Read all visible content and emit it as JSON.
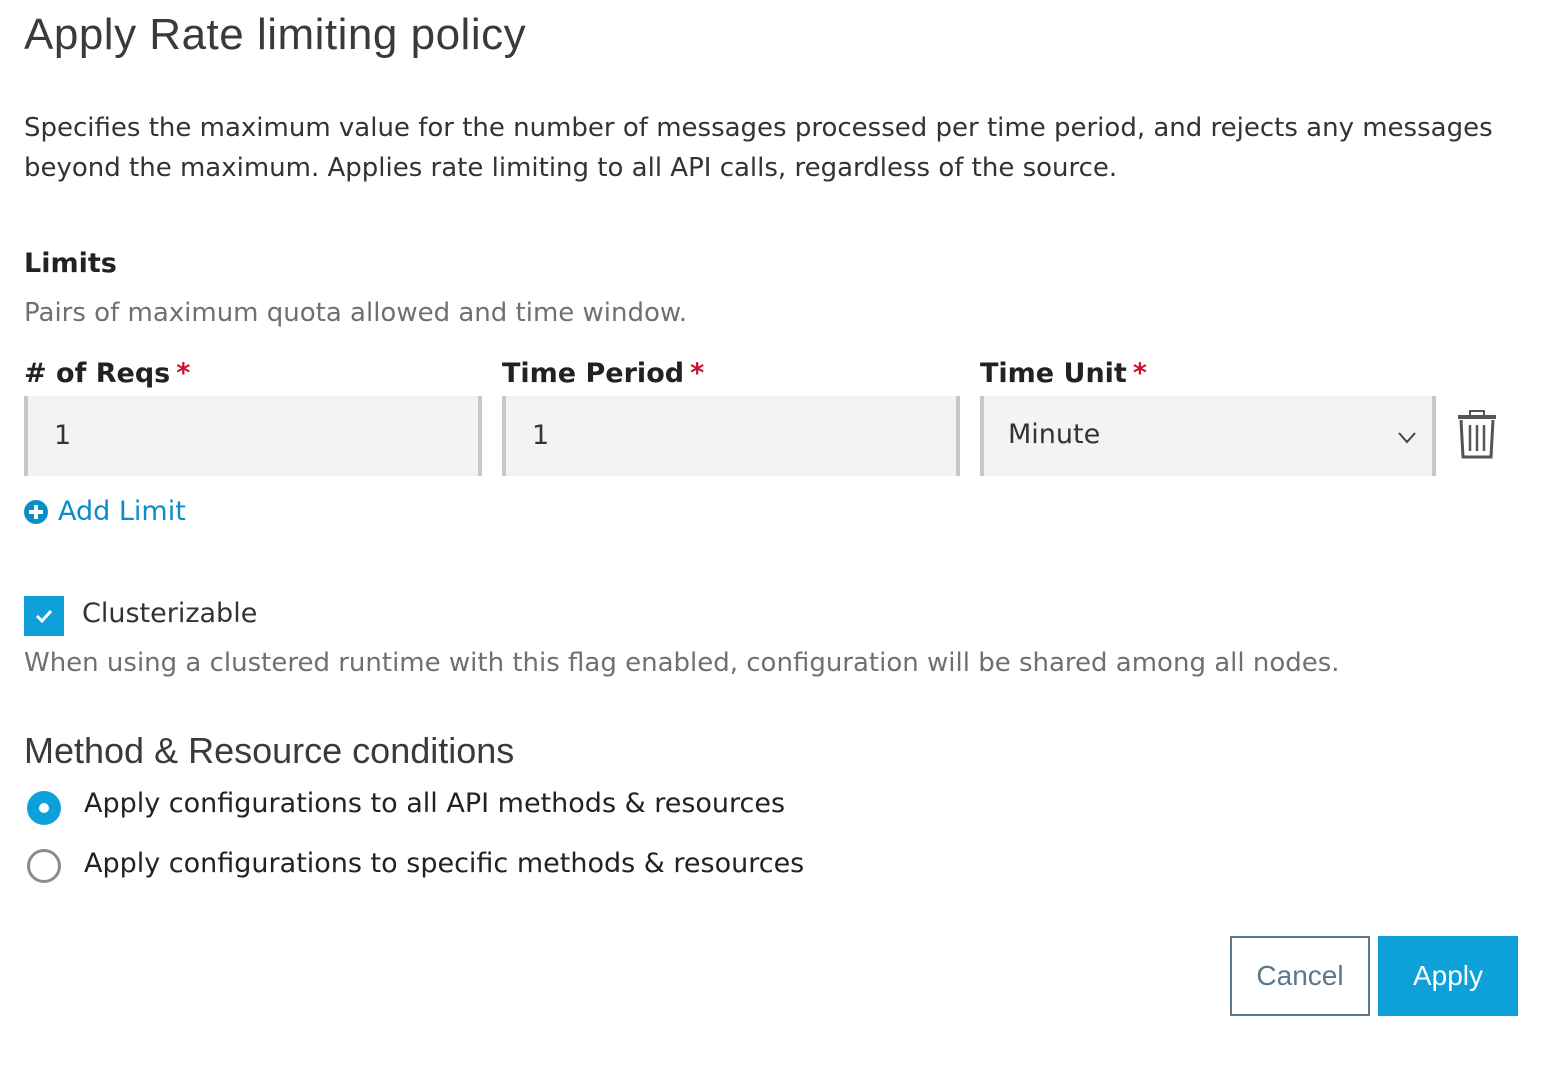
{
  "dialog": {
    "title": "Apply Rate limiting policy",
    "description": "Specifies the maximum value for the number of messages processed per time period, and rejects any messages beyond the maximum. Applies rate limiting to all API calls, regardless of the source."
  },
  "limits": {
    "heading": "Limits",
    "helper": "Pairs of maximum quota allowed and time window.",
    "required_marker": "*",
    "fields": {
      "reqs_label": "# of Reqs",
      "period_label": "Time Period",
      "unit_label": "Time Unit"
    },
    "row": {
      "reqs_value": "1",
      "period_value": "1",
      "unit_value": "Minute"
    },
    "add_limit_label": "Add Limit",
    "icons": {
      "delete": "trash-icon",
      "add": "plus-circle-icon",
      "dropdown": "chevron-down-icon"
    }
  },
  "cluster": {
    "label": "Clusterizable",
    "checked": true,
    "helper": "When using a clustered runtime with this flag enabled, configuration will be shared among all nodes."
  },
  "conditions": {
    "heading": "Method & Resource conditions",
    "options": [
      {
        "label": "Apply configurations to all API methods & resources",
        "selected": true
      },
      {
        "label": "Apply configurations to specific methods & resources",
        "selected": false
      }
    ]
  },
  "actions": {
    "cancel_label": "Cancel",
    "apply_label": "Apply"
  },
  "colors": {
    "accent": "#0ea0d9",
    "link": "#0a8ec9",
    "required": "#c8102e",
    "cancel_border": "#5d7688"
  }
}
